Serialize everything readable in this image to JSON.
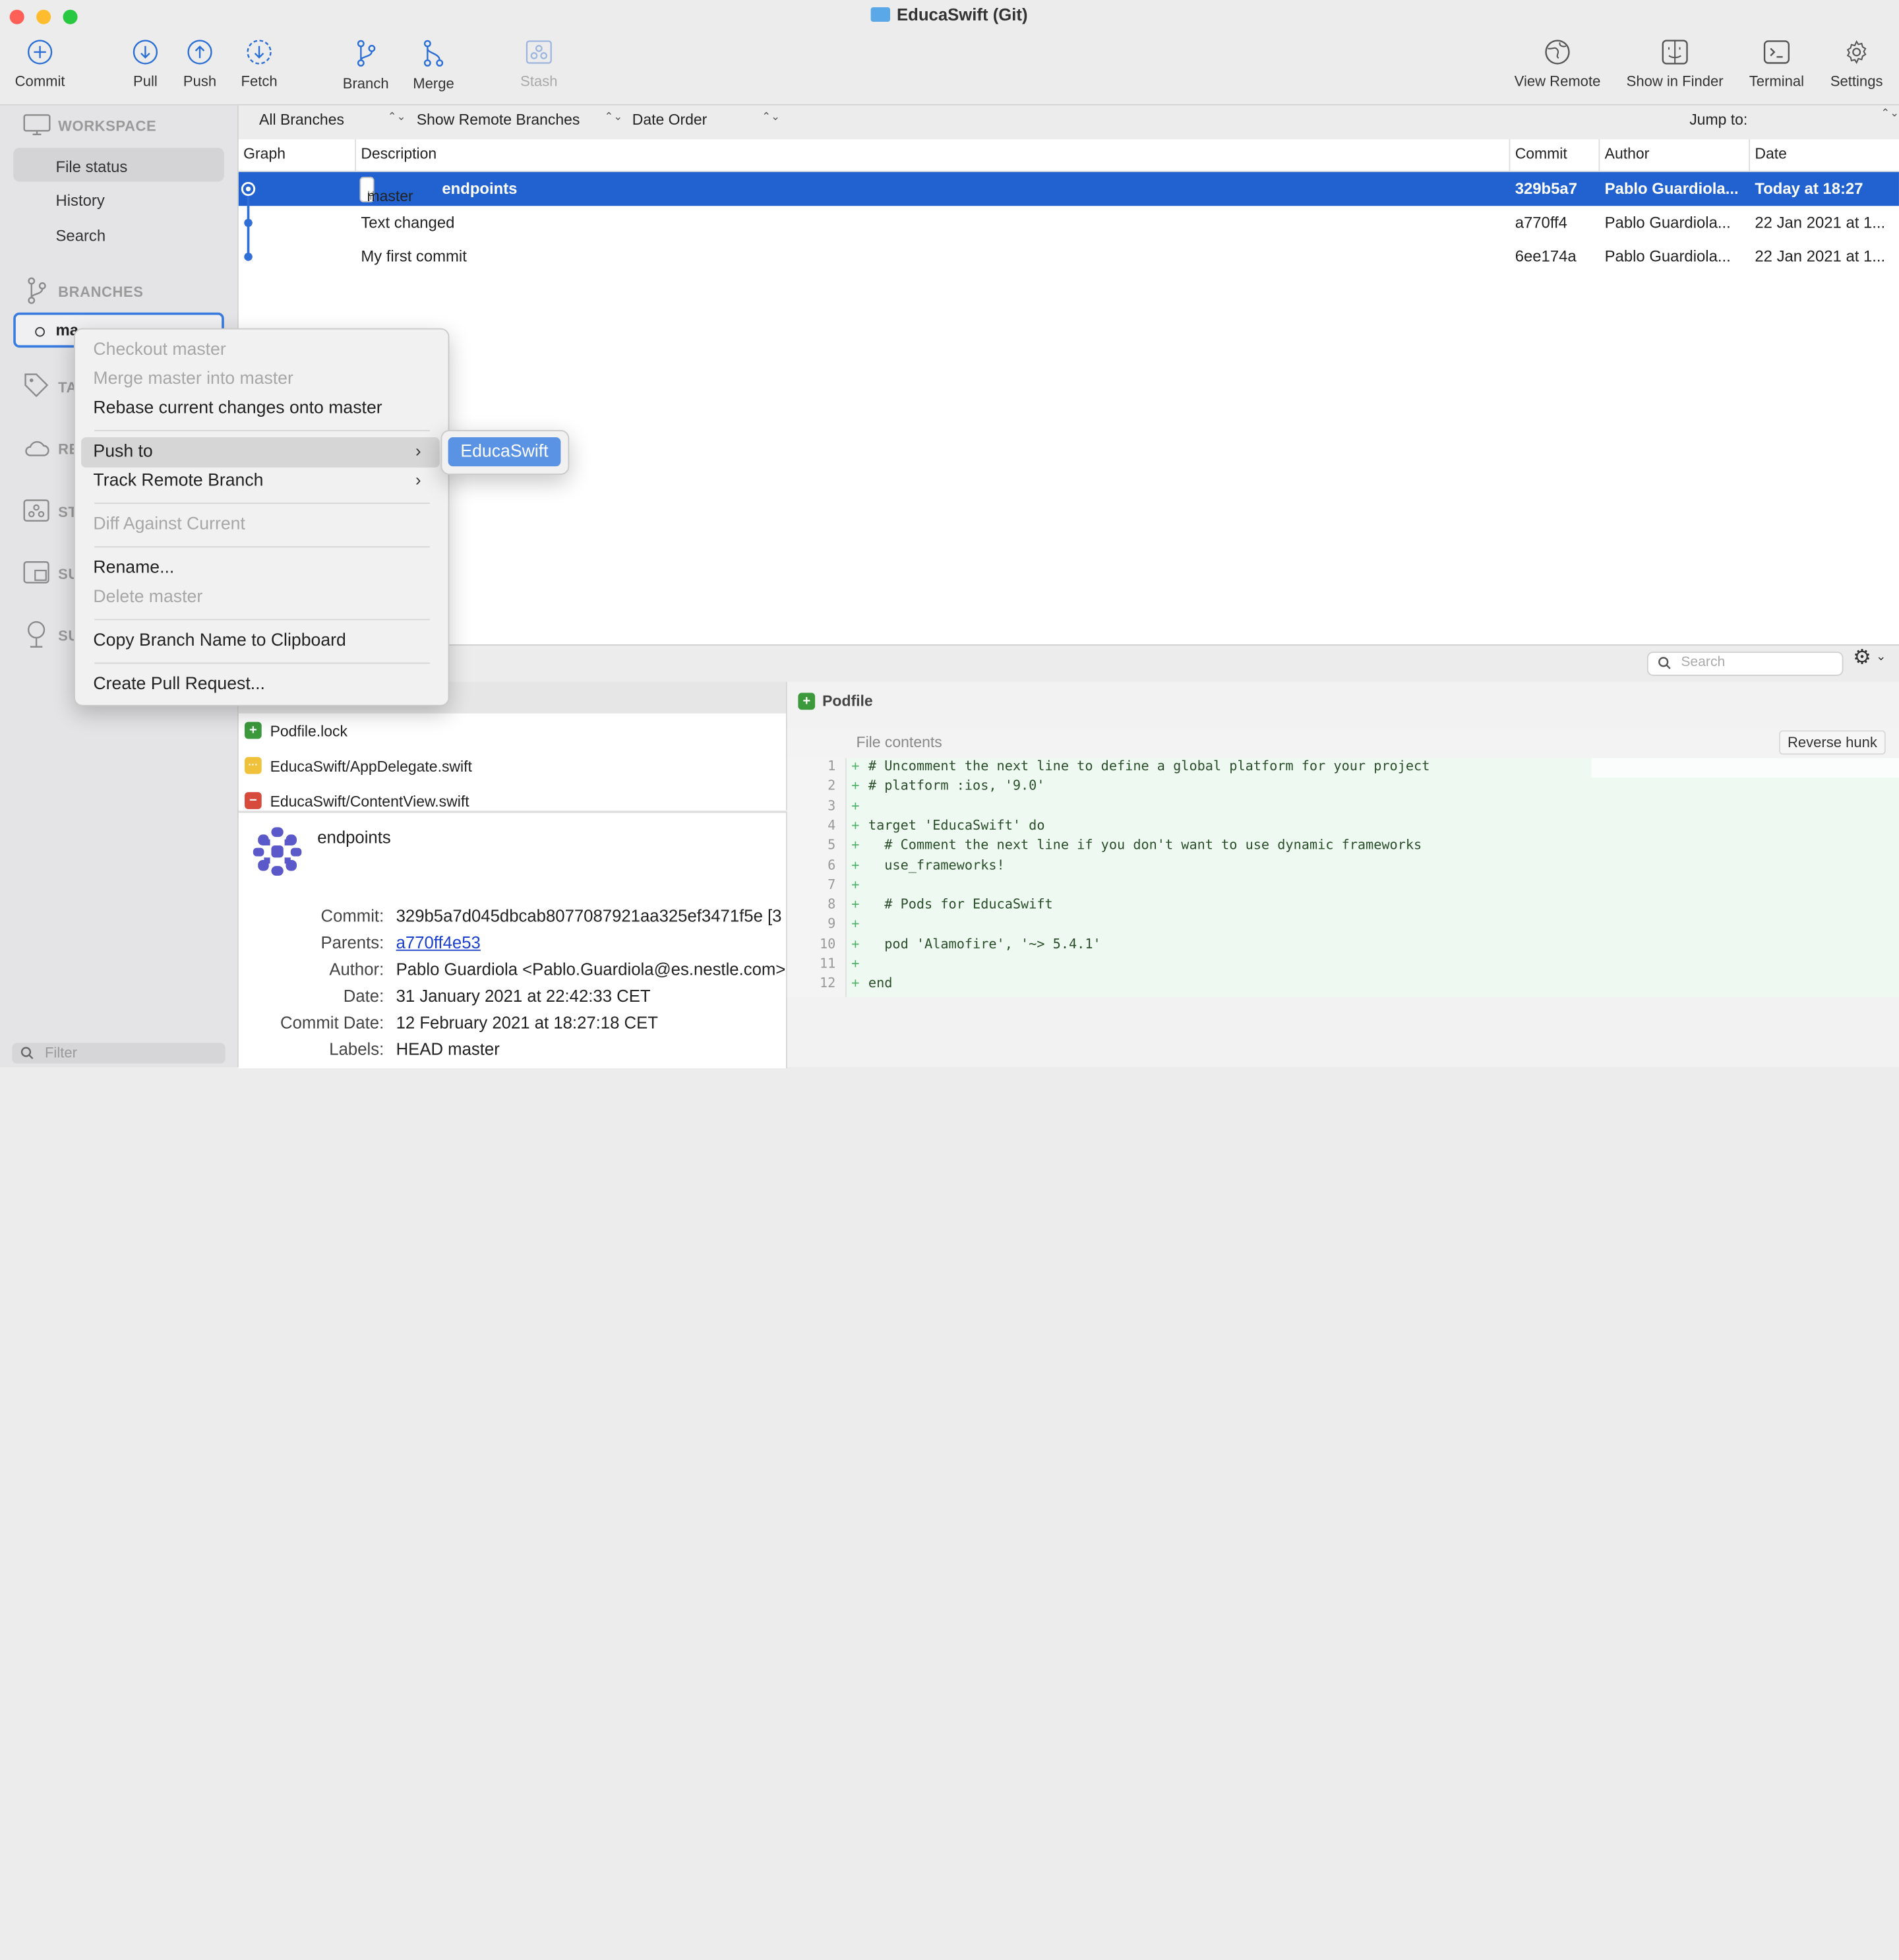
{
  "window": {
    "title": "EducaSwift (Git)"
  },
  "toolbar": {
    "commit": "Commit",
    "pull": "Pull",
    "push": "Push",
    "fetch": "Fetch",
    "branch": "Branch",
    "merge": "Merge",
    "stash": "Stash",
    "view_remote": "View Remote",
    "show_in_finder": "Show in Finder",
    "terminal": "Terminal",
    "settings": "Settings"
  },
  "sidebar": {
    "workspace": "WORKSPACE",
    "file_status": "File status",
    "history": "History",
    "search": "Search",
    "branches": "BRANCHES",
    "branch_master_partial": "ma",
    "tags_partial": "TA",
    "remotes_partial": "RE",
    "stashes_partial": "ST",
    "submodules_partial": "SU",
    "subtrees_partial": "SU",
    "filter_placeholder": "Filter"
  },
  "filterbar": {
    "branches": "All Branches",
    "remote": "Show Remote Branches",
    "order": "Date Order",
    "jump": "Jump to:"
  },
  "columns": {
    "graph": "Graph",
    "description": "Description",
    "commit": "Commit",
    "author": "Author",
    "date": "Date"
  },
  "commits": [
    {
      "branch": "master",
      "message": "endpoints",
      "hash": "329b5a7",
      "author": "Pablo Guardiola...",
      "date": "Today at 18:27"
    },
    {
      "message": "Text changed",
      "hash": "a770ff4",
      "author": "Pablo Guardiola...",
      "date": "22 Jan 2021 at 1..."
    },
    {
      "message": "My first commit",
      "hash": "6ee174a",
      "author": "Pablo Guardiola...",
      "date": "22 Jan 2021 at 1..."
    }
  ],
  "search": {
    "placeholder": "Search"
  },
  "files": [
    {
      "name": "Podfile.lock",
      "status": "added",
      "symbol": "+",
      "color": "#3c9a3c"
    },
    {
      "name": "EducaSwift/AppDelegate.swift",
      "status": "modified",
      "symbol": "···",
      "color": "#f0c23c"
    },
    {
      "name": "EducaSwift/ContentView.swift",
      "status": "removed",
      "symbol": "−",
      "color": "#d64b3c"
    }
  ],
  "details": {
    "message": "endpoints",
    "commit_label": "Commit:",
    "commit": "329b5a7d045dbcab8077087921aa325ef3471f5e [3",
    "parents_label": "Parents:",
    "parents": "a770ff4e53",
    "author_label": "Author:",
    "author": "Pablo Guardiola <Pablo.Guardiola@es.nestle.com>",
    "date_label": "Date:",
    "date": "31 January 2021 at 22:42:33 CET",
    "commit_date_label": "Commit Date:",
    "commit_date": "12 February 2021 at 18:27:18 CET",
    "labels_label": "Labels:",
    "labels": "HEAD master"
  },
  "diff": {
    "file": "Podfile",
    "hunk": "File contents",
    "reverse": "Reverse hunk",
    "lines": [
      {
        "n": "1",
        "text": "# Uncomment the next line to define a global platform for your project"
      },
      {
        "n": "2",
        "text": "# platform :ios, '9.0'"
      },
      {
        "n": "3",
        "text": ""
      },
      {
        "n": "4",
        "text": "target 'EducaSwift' do"
      },
      {
        "n": "5",
        "text": "  # Comment the next line if you don't want to use dynamic frameworks"
      },
      {
        "n": "6",
        "text": "  use_frameworks!"
      },
      {
        "n": "7",
        "text": ""
      },
      {
        "n": "8",
        "text": "  # Pods for EducaSwift"
      },
      {
        "n": "9",
        "text": ""
      },
      {
        "n": "10",
        "text": "  pod 'Alamofire', '~> 5.4.1'"
      },
      {
        "n": "11",
        "text": ""
      },
      {
        "n": "12",
        "text": "end"
      }
    ]
  },
  "context_menu": {
    "checkout": "Checkout master",
    "merge": "Merge master into master",
    "rebase": "Rebase current changes onto master",
    "push_to": "Push to",
    "track": "Track Remote Branch",
    "diff": "Diff Against Current",
    "rename": "Rename...",
    "delete": "Delete master",
    "copy": "Copy Branch Name to Clipboard",
    "pr": "Create Pull Request..."
  },
  "submenu": {
    "remote": "EducaSwift"
  },
  "colors": {
    "selection": "#2162d0",
    "accent": "#1e6fd9",
    "diff_bg": "#eefaf1"
  }
}
